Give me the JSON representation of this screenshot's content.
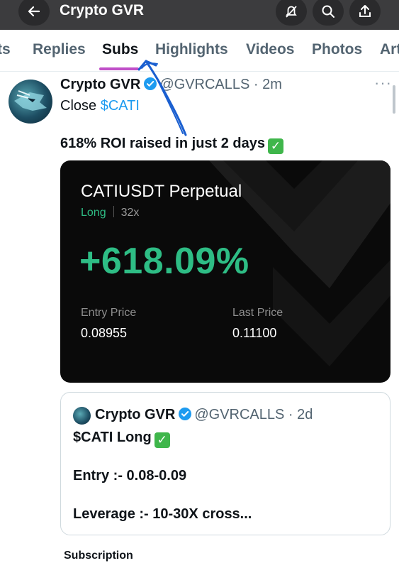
{
  "header": {
    "title": "Crypto GVR",
    "back_icon": "arrow-left-icon",
    "icons": [
      "notifications-off-icon",
      "search-icon",
      "share-icon"
    ]
  },
  "tabs": [
    {
      "label": "ts"
    },
    {
      "label": "Replies"
    },
    {
      "label": "Subs",
      "active": true
    },
    {
      "label": "Highlights"
    },
    {
      "label": "Videos"
    },
    {
      "label": "Photos"
    },
    {
      "label": "Art"
    }
  ],
  "tweet": {
    "name": "Crypto GVR",
    "handle": "@GVRCALLS",
    "time": "2m",
    "line1_prefix": "Close ",
    "cashtag": "$CATI",
    "line2": "618% ROI raised in just 2 days",
    "more": "···"
  },
  "pnl_card": {
    "pair": "CATIUSDT Perpetual",
    "side": "Long",
    "leverage": "32x",
    "roi": "+618.09%",
    "entry_label": "Entry Price",
    "entry_value": "0.08955",
    "last_label": "Last Price",
    "last_value": "0.11100"
  },
  "quote": {
    "name": "Crypto GVR",
    "handle": "@GVRCALLS",
    "time": "2d",
    "line1": "$CATI Long",
    "line2": "Entry :- 0.08-0.09",
    "line3": "Leverage :- 10-30X cross..."
  },
  "footer": {
    "subscription": "Subscription"
  },
  "colors": {
    "accent_blue": "#1d9bf0",
    "profit_green": "#2ebd85",
    "tab_underline": "#c04fc8",
    "annotation_ink": "#1a5fd0"
  }
}
